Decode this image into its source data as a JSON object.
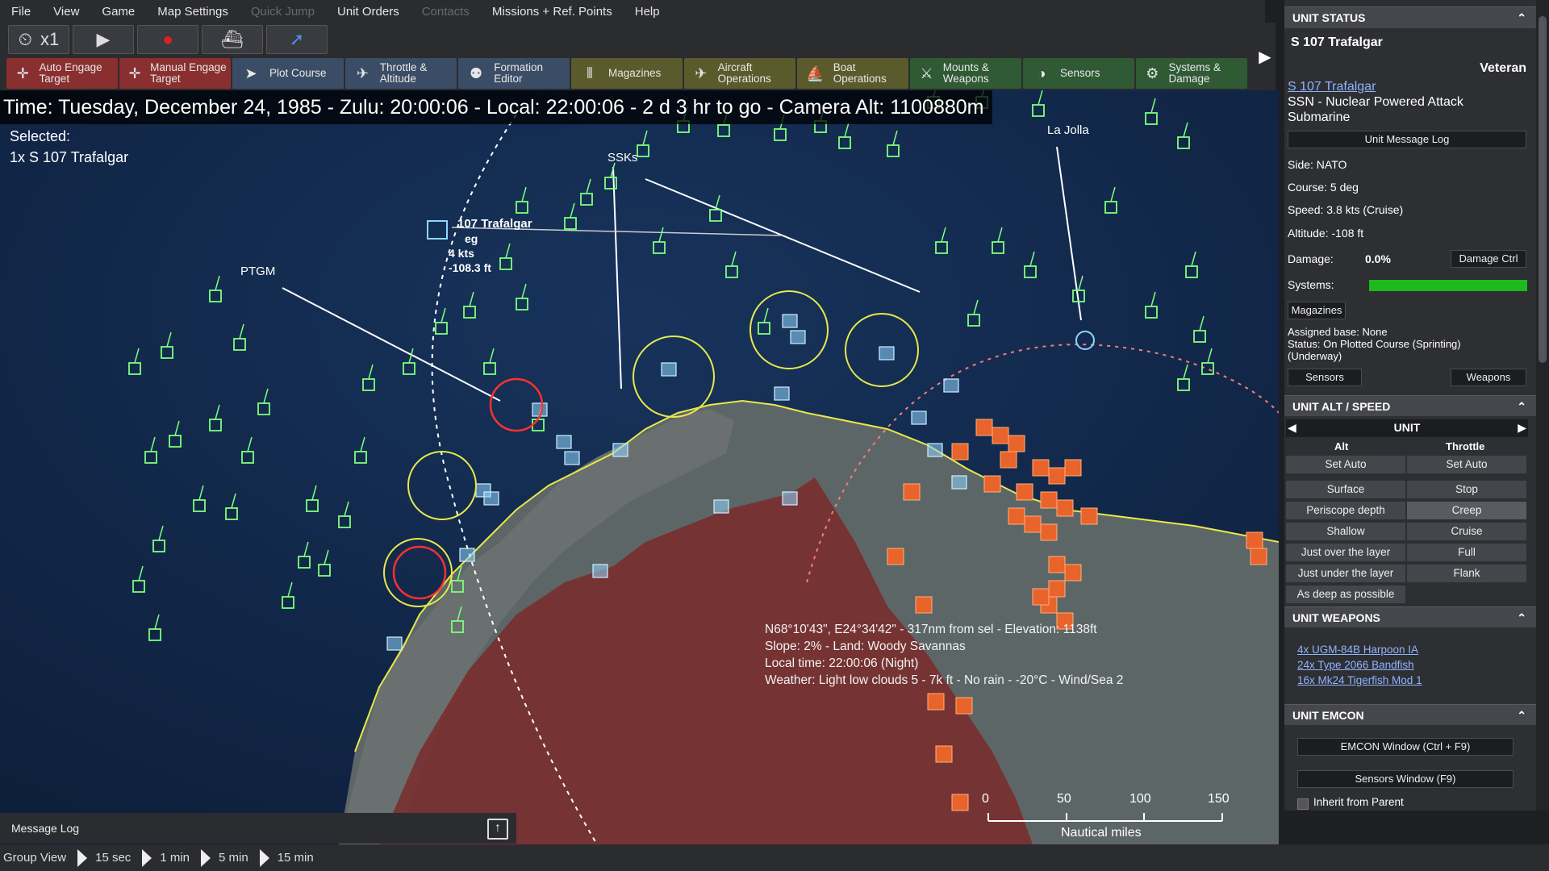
{
  "menu": [
    "File",
    "View",
    "Game",
    "Map Settings",
    "Quick Jump",
    "Unit Orders",
    "Contacts",
    "Missions + Ref. Points",
    "Help"
  ],
  "menu_disabled": [
    "Quick Jump",
    "Contacts"
  ],
  "speed": {
    "mult": "x1"
  },
  "toolbar": [
    {
      "label": "Auto Engage Target",
      "color": "#8a2f2f"
    },
    {
      "label": "Manual Engage Target",
      "color": "#8a2f2f"
    },
    {
      "label": "Plot Course",
      "color": "#3b4d66"
    },
    {
      "label": "Throttle & Altitude",
      "color": "#3b4d66"
    },
    {
      "label": "Formation Editor",
      "color": "#3b4d66"
    },
    {
      "label": "Magazines",
      "color": "#5a5a2c"
    },
    {
      "label": "Aircraft Operations",
      "color": "#5a5a2c"
    },
    {
      "label": "Boat Operations",
      "color": "#5a5a2c"
    },
    {
      "label": "Mounts & Weapons",
      "color": "#2f5a34"
    },
    {
      "label": "Sensors",
      "color": "#2f5a34"
    },
    {
      "label": "Systems & Damage",
      "color": "#2f5a34"
    }
  ],
  "timebar": "Time: Tuesday, December 24, 1985 - Zulu: 20:00:06 - Local: 22:00:06 - 2 d 3 hr to go -  Camera Alt: 1100880m",
  "selected": {
    "label": "Selected:",
    "value": "1x S 107 Trafalgar"
  },
  "map_labels": {
    "trafalgar": "107 Trafalgar",
    "trafalgar_course": "eg",
    "trafalgar_speed": "4 kts",
    "trafalgar_depth": "-108.3 ft",
    "ptgm": "PTGM",
    "ssks": "SSKs",
    "lajolla": "La Jolla"
  },
  "cursor_info": [
    "N68°10'43\", E24°34'42\" - 317nm from sel - Elevation: 1138ft",
    "Slope: 2% - Land: Woody Savannas",
    "Local time: 22:00:06 (Night)",
    "Weather: Light low clouds 5 - 7k ft - No rain - -20°C - Wind/Sea 2"
  ],
  "scale": {
    "ticks": [
      "0",
      "50",
      "100",
      "150"
    ],
    "unit": "Nautical miles"
  },
  "message_log": "Message Log",
  "bottom": {
    "group_view": "Group View",
    "steps": [
      "15 sec",
      "1 min",
      "5 min",
      "15 min"
    ]
  },
  "status": {
    "header": "UNIT STATUS",
    "name": "S 107 Trafalgar",
    "rank": "Veteran",
    "link": "S 107 Trafalgar",
    "type_line1": "SSN - Nuclear Powered Attack",
    "type_line2": "Submarine",
    "msg_log_btn": "Unit Message Log",
    "side": "Side: NATO",
    "course": "Course: 5 deg",
    "speed": "Speed: 3.8 kts (Cruise)",
    "altitude": "Altitude: -108 ft",
    "damage_label": "Damage:",
    "damage_value": "0.0%",
    "damage_btn": "Damage Ctrl",
    "systems_label": "Systems:",
    "systems_health": 1.0,
    "magazines_btn": "Magazines",
    "assigned_base": "Assigned base: None",
    "status_line1": "Status: On Plotted Course (Sprinting)",
    "status_line2": "(Underway)",
    "sensors_btn": "Sensors",
    "weapons_btn": "Weapons"
  },
  "altspeed": {
    "header": "UNIT ALT / SPEED",
    "unit": "UNIT",
    "alt_col": "Alt",
    "throttle_col": "Throttle",
    "alt": [
      "Set Auto",
      "Surface",
      "Periscope depth",
      "Shallow",
      "Just over the layer",
      "Just under the layer",
      "As deep as possible"
    ],
    "throttle": [
      "Set Auto",
      "Stop",
      "Creep",
      "Cruise",
      "Full",
      "Flank"
    ]
  },
  "weapons": {
    "header": "UNIT WEAPONS",
    "items": [
      "4x UGM-84B Harpoon IA",
      "24x Type 2066 Bandfish",
      "16x Mk24 Tigerfish Mod 1"
    ]
  },
  "emcon": {
    "header": "UNIT EMCON",
    "btn1": "EMCON Window (Ctrl + F9)",
    "btn2": "Sensors Window (F9)",
    "inherit": "Inherit from Parent"
  },
  "colors": {
    "contact": "#7dff7d",
    "coast": "#e8e84a",
    "hostile_land": "#7a2a2a",
    "hostile_unit": "#e8642a",
    "friendly": "#8fd6ff"
  }
}
